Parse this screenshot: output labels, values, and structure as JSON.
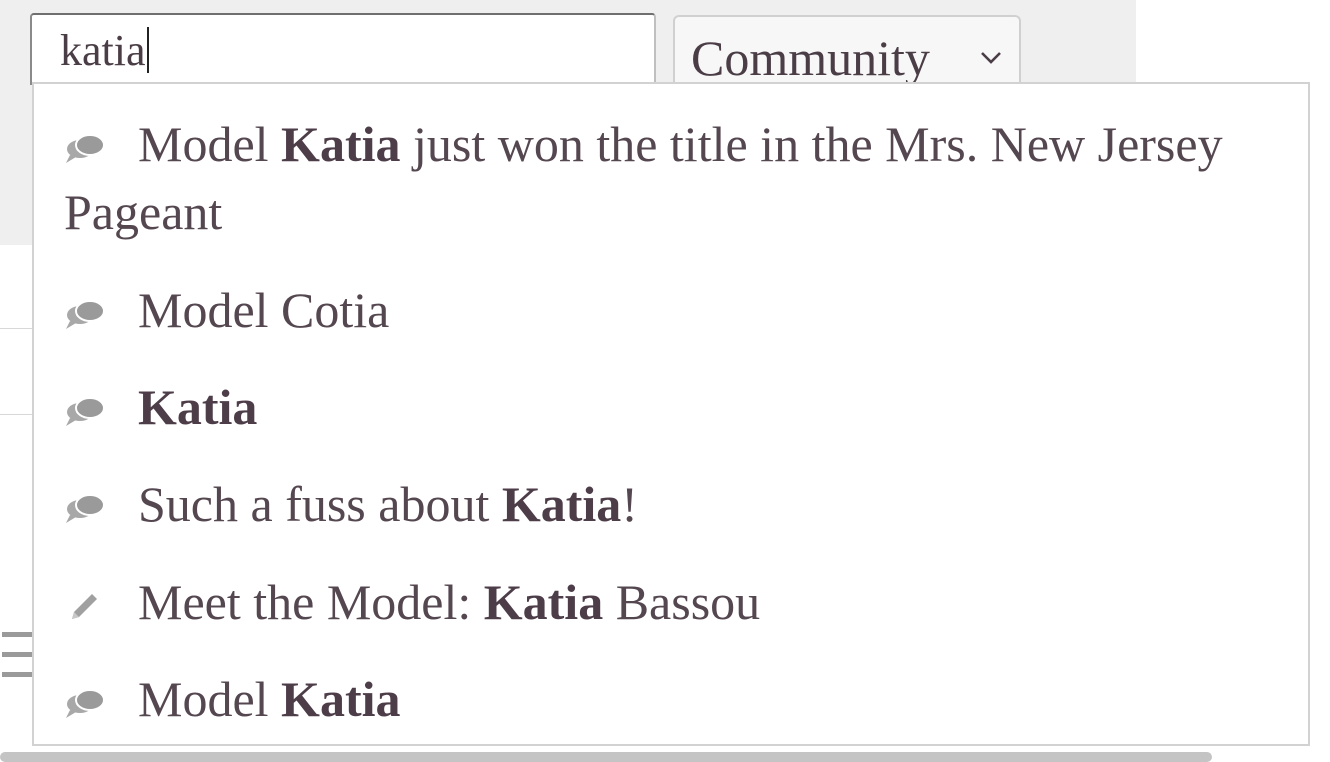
{
  "search": {
    "value": "katia"
  },
  "scope_select": {
    "selected": "Community"
  },
  "suggestions": [
    {
      "icon": "comment-icon",
      "before": "Model ",
      "match": "Katia",
      "after": " just won the title in the Mrs. New Jersey Pageant"
    },
    {
      "icon": "comment-icon",
      "before": "Model Cotia",
      "match": "",
      "after": ""
    },
    {
      "icon": "comment-icon",
      "before": "",
      "match": "Katia",
      "after": ""
    },
    {
      "icon": "comment-icon",
      "before": "Such a fuss about ",
      "match": "Katia",
      "after": "!"
    },
    {
      "icon": "pencil-icon",
      "before": "Meet the Model: ",
      "match": "Katia",
      "after": " Bassou"
    },
    {
      "icon": "comment-icon",
      "before": "Model ",
      "match": "Katia",
      "after": ""
    }
  ],
  "colors": {
    "text": "#554750",
    "icon": "#a0a0a0",
    "header_bg": "#efefef"
  }
}
